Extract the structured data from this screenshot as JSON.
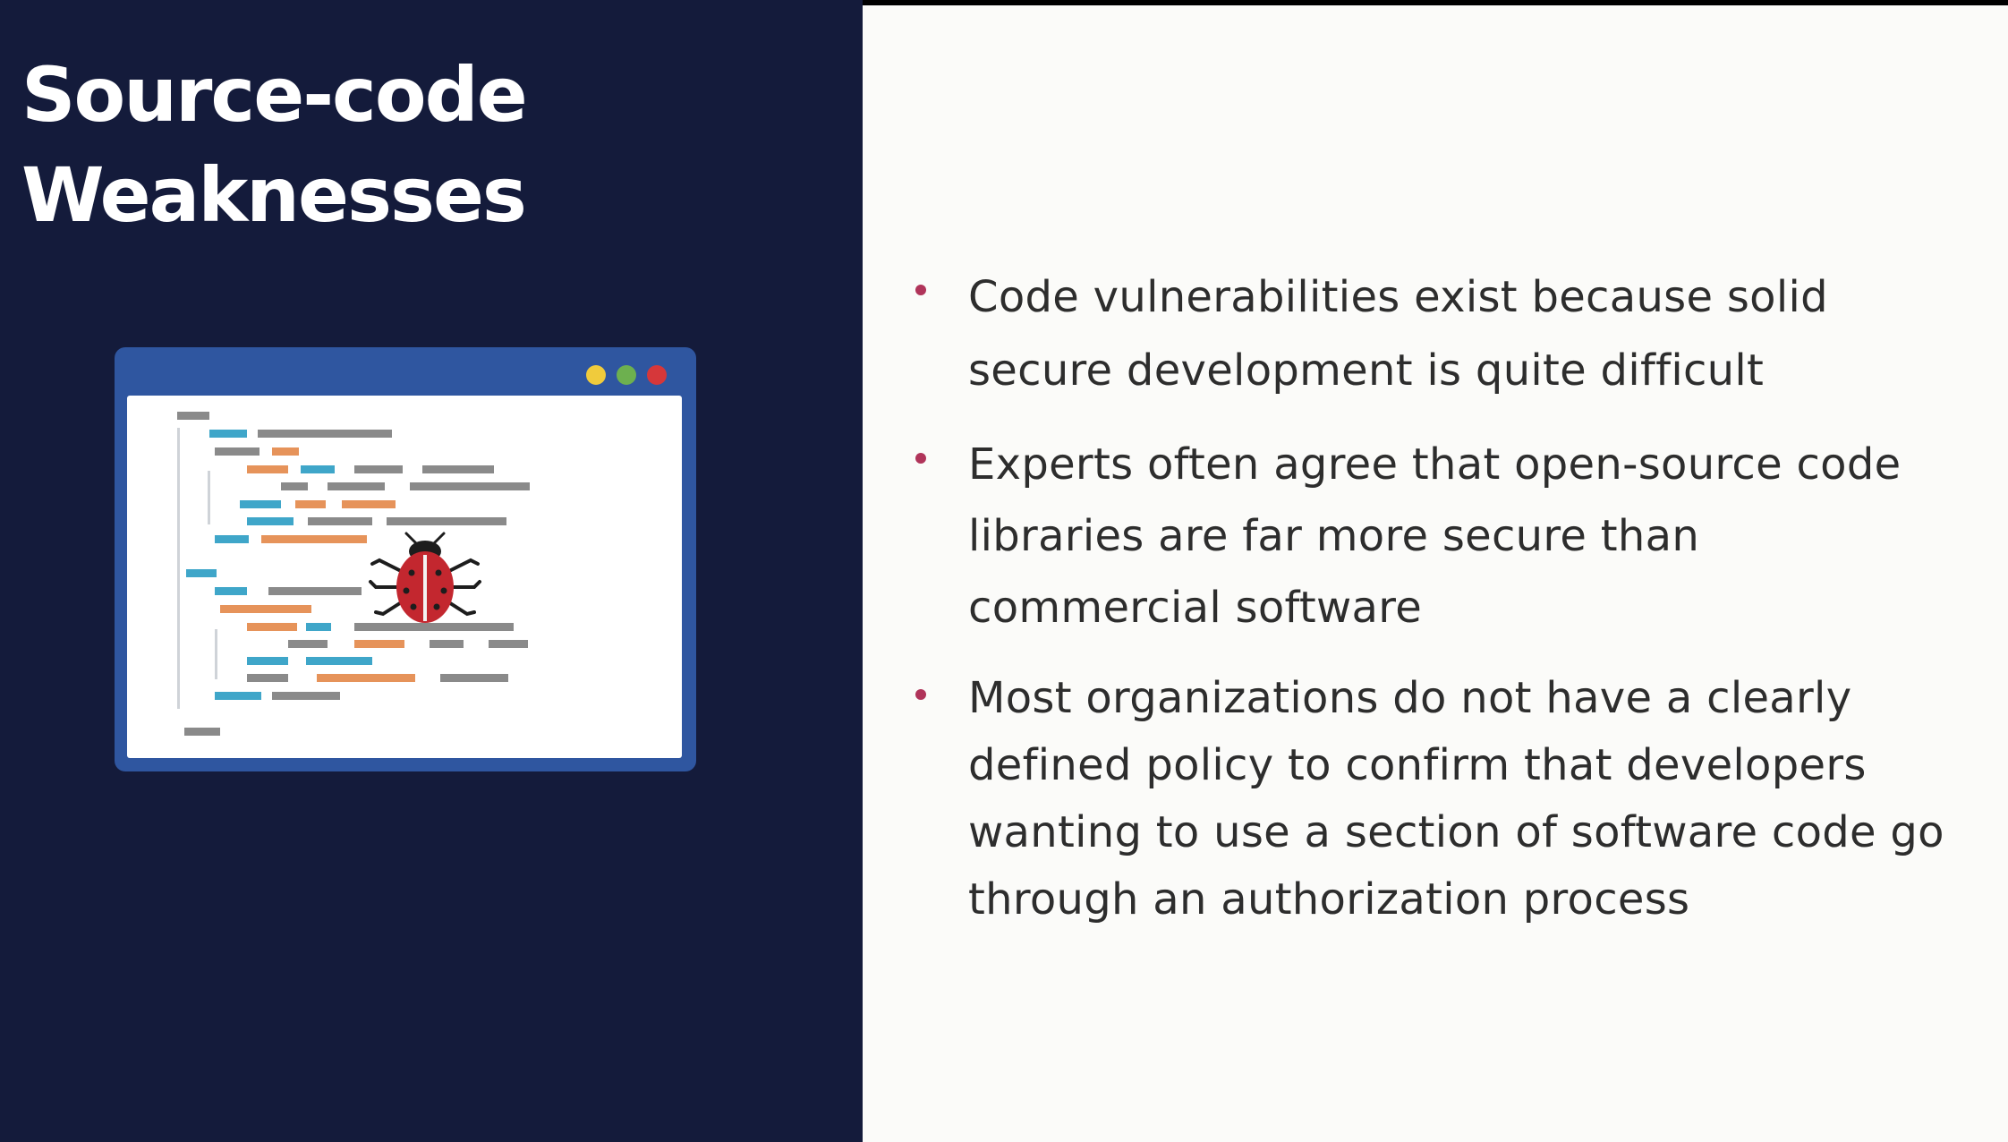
{
  "slide": {
    "title_line1": "Source-code",
    "title_line2": "Weaknesses",
    "bullets": [
      "Code vulnerabilities exist because solid secure development is quite difficult",
      "Experts often agree that open-source code libraries are far more secure than commercial software",
      "Most organizations do not have a clearly defined policy to confirm that developers wanting to use a section of software code go through an authorization process"
    ]
  },
  "illustration": {
    "icon": "bug-in-code-window-icon",
    "colors": {
      "window_frame": "#2f56a0",
      "code_blue": "#3fa6c9",
      "code_orange": "#e6935a",
      "code_gray": "#8a8a8a",
      "bug_red": "#c3272f",
      "dot_yellow": "#f0cb3c",
      "dot_green": "#6db04f",
      "dot_red": "#d6373a"
    }
  },
  "colors": {
    "left_background": "#141b3b",
    "right_background": "#fbfbf9",
    "bullet_accent": "#b0345a",
    "body_text": "#2d2d2d"
  }
}
